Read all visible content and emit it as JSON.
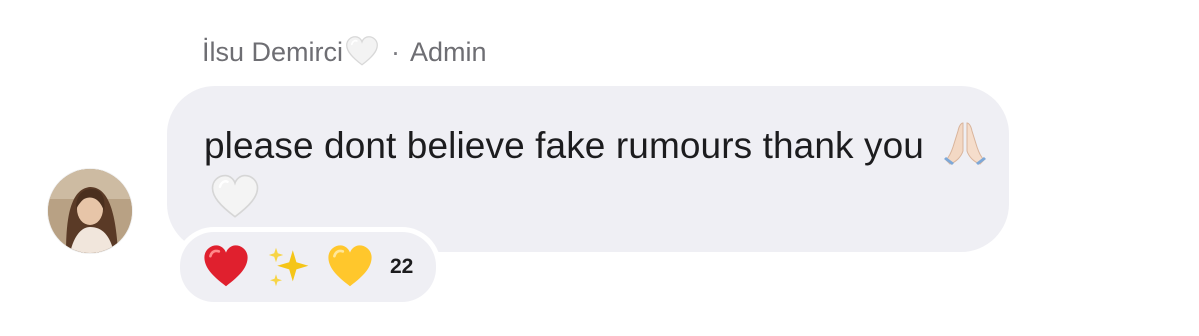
{
  "header": {
    "sender_name": "İlsu Demirci",
    "sender_badge_icon": "white-heart-icon",
    "separator": "·",
    "role": "Admin"
  },
  "message": {
    "text": "please dont believe fake rumours thank you",
    "trailing_emoji": [
      "folded-hands-icon",
      "white-heart-icon"
    ]
  },
  "reactions": {
    "items": [
      "red-heart-icon",
      "sparkles-icon",
      "yellow-heart-icon"
    ],
    "count": "22"
  },
  "colors": {
    "bubble": "#efeff4",
    "meta_text": "#7a7a80",
    "body_text": "#1c1c1e"
  }
}
